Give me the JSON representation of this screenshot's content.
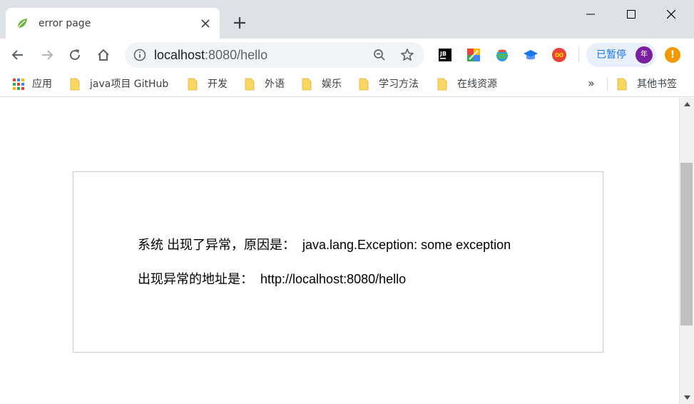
{
  "tab": {
    "title": "error page",
    "favicon": "spring-leaf-icon",
    "close_icon": "close-icon"
  },
  "window_controls": [
    "minimize-icon",
    "maximize-icon",
    "close-icon"
  ],
  "toolbar": {
    "url_host": "localhost",
    "url_rest": ":8080/hello",
    "paused_label": "已暂停",
    "avatar_text": "年",
    "alert_text": "!",
    "extensions": [
      "jetbrains-icon",
      "colorzilla-icon",
      "globe-extension-icon",
      "graduation-cap-icon",
      "infinity-icon"
    ]
  },
  "bookmarks": {
    "apps_label": "应用",
    "items": [
      {
        "label": "java项目 GitHub"
      },
      {
        "label": "开发"
      },
      {
        "label": "外语"
      },
      {
        "label": "娱乐"
      },
      {
        "label": "学习方法"
      },
      {
        "label": "在线资源"
      }
    ],
    "overflow": "»",
    "other_label": "其他书签"
  },
  "error": {
    "line1_label": "系统 出现了异常，原因是：",
    "line1_value": "java.lang.Exception: some exception",
    "line2_label": "出现异常的地址是：",
    "line2_value": "http://localhost:8080/hello"
  },
  "colors": {
    "tab_strip": "#dee1e6",
    "omnibox": "#f1f3f4",
    "folder": "#fbd661",
    "avatar": "#7b1fa2",
    "alert": "#f29900",
    "paused_chip": "#e8f0fe"
  }
}
